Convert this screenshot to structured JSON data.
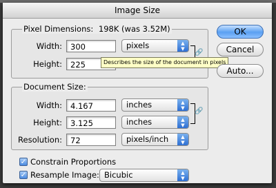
{
  "dialog": {
    "title": "Image Size"
  },
  "pixel_dimensions": {
    "title": "Pixel Dimensions:",
    "size_text": "198K (was 3.52M)",
    "width_label": "Width:",
    "width_value": "300",
    "width_unit": "pixels",
    "height_label": "Height:",
    "height_value": "225",
    "tooltip": "Describes the size of the document in pixels"
  },
  "document_size": {
    "title": "Document Size:",
    "width_label": "Width:",
    "width_value": "4.167",
    "width_unit": "inches",
    "height_label": "Height:",
    "height_value": "3.125",
    "height_unit": "inches",
    "resolution_label": "Resolution:",
    "resolution_value": "72",
    "resolution_unit": "pixels/inch"
  },
  "buttons": {
    "ok": "OK",
    "cancel": "Cancel",
    "auto": "Auto..."
  },
  "options": {
    "constrain_label": "Constrain Proportions",
    "constrain_checked": true,
    "resample_label": "Resample Image:",
    "resample_checked": true,
    "resample_value": "Bicubic"
  },
  "icons": {
    "chain": "link-icon",
    "popup": "popup-arrows-icon",
    "check": "checkmark-icon"
  },
  "colors": {
    "accent": "#4b8ae0",
    "tooltip_bg": "#ffffc6",
    "dialog_bg": "#ececec"
  }
}
